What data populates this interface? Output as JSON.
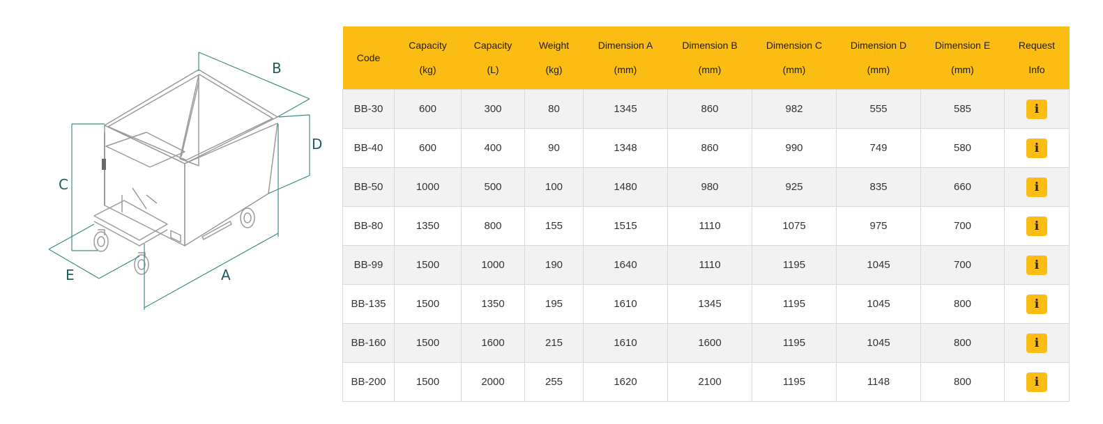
{
  "diagram": {
    "labels": {
      "a": "A",
      "b": "B",
      "c": "C",
      "d": "D",
      "e": "E"
    },
    "colors": {
      "dimension_line": "#3d8a86",
      "outline": "#9a9a9a",
      "label": "#1f5b5b"
    }
  },
  "table": {
    "headers": [
      {
        "l1": "",
        "l2": "Code"
      },
      {
        "l1": "Capacity",
        "l2": "(kg)"
      },
      {
        "l1": "Capacity",
        "l2": "(L)"
      },
      {
        "l1": "Weight",
        "l2": "(kg)"
      },
      {
        "l1": "Dimension A",
        "l2": "(mm)"
      },
      {
        "l1": "Dimension B",
        "l2": "(mm)"
      },
      {
        "l1": "Dimension C",
        "l2": "(mm)"
      },
      {
        "l1": "Dimension D",
        "l2": "(mm)"
      },
      {
        "l1": "Dimension E",
        "l2": "(mm)"
      },
      {
        "l1": "Request",
        "l2": "Info"
      }
    ],
    "rows": [
      [
        "BB-30",
        "600",
        "300",
        "80",
        "1345",
        "860",
        "982",
        "555",
        "585"
      ],
      [
        "BB-40",
        "600",
        "400",
        "90",
        "1348",
        "860",
        "990",
        "749",
        "580"
      ],
      [
        "BB-50",
        "1000",
        "500",
        "100",
        "1480",
        "980",
        "925",
        "835",
        "660"
      ],
      [
        "BB-80",
        "1350",
        "800",
        "155",
        "1515",
        "1110",
        "1075",
        "975",
        "700"
      ],
      [
        "BB-99",
        "1500",
        "1000",
        "190",
        "1640",
        "1110",
        "1195",
        "1045",
        "700"
      ],
      [
        "BB-135",
        "1500",
        "1350",
        "195",
        "1610",
        "1345",
        "1195",
        "1045",
        "800"
      ],
      [
        "BB-160",
        "1500",
        "1600",
        "215",
        "1610",
        "1600",
        "1195",
        "1045",
        "800"
      ],
      [
        "BB-200",
        "1500",
        "2000",
        "255",
        "1620",
        "2100",
        "1195",
        "1148",
        "800"
      ]
    ],
    "info_button": {
      "label": "i",
      "icon": "info-icon"
    },
    "colors": {
      "header_bg": "#fbbd14",
      "row_alt_bg": "#f2f2f2",
      "button_bg": "#fbbd14"
    }
  }
}
